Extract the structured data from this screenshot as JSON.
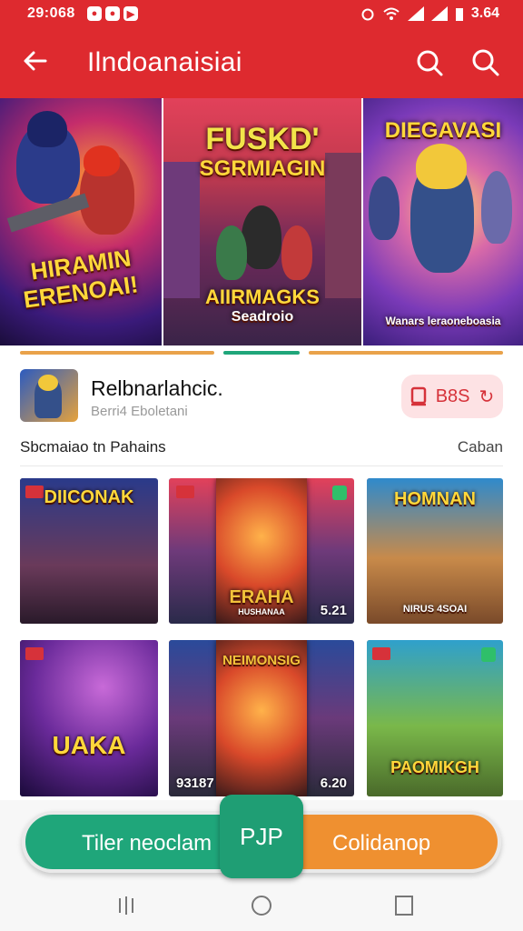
{
  "status_bar": {
    "time": "29:068",
    "right_text": "3.64",
    "left_icons": [
      "notification-icon",
      "notification-icon",
      "youtube-icon"
    ],
    "right_icons": [
      "alarm-icon",
      "wifi-icon",
      "signal-icon",
      "signal-icon",
      "battery-icon"
    ]
  },
  "app_bar": {
    "title": "Ilndoanaisiai",
    "icons": [
      "back-arrow-icon",
      "search-icon",
      "search-icon"
    ]
  },
  "banners": [
    {
      "caption_line1": "HIRAMIN",
      "caption_line2": "ERENOAI!"
    },
    {
      "caption_top1": "FUSKD'",
      "caption_top2": "SGRMIAGIN",
      "caption_bottom1": "AIIRMAGKS",
      "caption_bottom2": "Seadroio"
    },
    {
      "caption_top": "DIEGAVASI",
      "caption_bottom": "Wanars leraoneboasia"
    }
  ],
  "featured": {
    "name": "Relbnarlahcic.",
    "subtitle": "Berri4 Eboletani",
    "button_label": "B8S"
  },
  "section": {
    "title": "Sbcmaiao tn Pahains",
    "link": "Caban"
  },
  "tiles": [
    {
      "caption": "DIICONAK",
      "number": ""
    },
    {
      "caption": "ERAHA",
      "sub": "HUSHANAA",
      "number": "5.21"
    },
    {
      "caption": "HOMNAN",
      "sub": "NIRUS 4SOAI",
      "number": ""
    },
    {
      "caption": "UAKA",
      "number": ""
    },
    {
      "caption": "NEIMONSIG",
      "number_left": "93187",
      "number": "6.20"
    },
    {
      "caption": "PAOMIKGH",
      "number": ""
    }
  ],
  "actions": {
    "left_label": "Tiler neoclam",
    "center_label": "PJP",
    "right_label": "Colidanop"
  },
  "colors": {
    "primary": "#de2a2f",
    "green": "#1fa67a",
    "orange": "#ef9030",
    "pink_bg": "#fde2e4"
  }
}
